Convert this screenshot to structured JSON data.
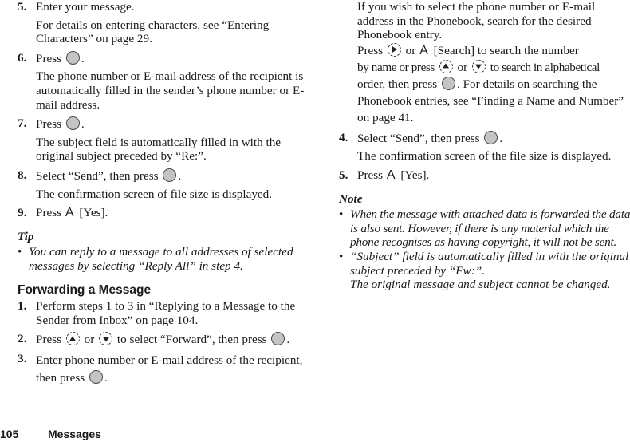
{
  "left_column": {
    "steps_top": [
      {
        "num": "5.",
        "text": "Enter your message.",
        "detail": "For details on entering characters, see “Entering Characters” on page 29."
      },
      {
        "num": "6.",
        "press_label": "Press",
        "press_suffix": ".",
        "detail": "The phone number or E-mail address of the recipient is automatically filled in the sender’s phone number or E-mail address."
      },
      {
        "num": "7.",
        "press_label": "Press",
        "press_suffix": ".",
        "detail": "The subject field is automatically filled in with the original subject preceded by “Re:”."
      },
      {
        "num": "8.",
        "text_before": "Select “Send”, then press",
        "text_after": ".",
        "detail": "The confirmation screen of file size is displayed."
      },
      {
        "num": "9.",
        "press_label": "Press",
        "softkey": "A",
        "action": "[Yes]."
      }
    ],
    "tip": {
      "label": "Tip",
      "bullets": [
        "You can reply to a message to all addresses of selected messages by selecting “Reply All” in step 4."
      ]
    },
    "section_heading": "Forwarding a Message",
    "steps_forward": [
      {
        "num": "1.",
        "text": "Perform steps 1 to 3 in “Replying to a Message to the Sender from Inbox” on page 104."
      },
      {
        "num": "2.",
        "press_label": "Press",
        "or_label": "or",
        "text_middle": "to select “Forward”, then press",
        "text_after": "."
      },
      {
        "num": "3.",
        "text_before": "Enter phone number or E-mail address of the recipient, then press",
        "text_after": "."
      }
    ]
  },
  "right_column": {
    "continuation": {
      "intro": "If you wish to select the phone number or E-mail address in the Phonebook, search for the desired Phonebook entry.",
      "press_label": "Press",
      "or_label": "or",
      "softkey": "A",
      "search_text": "[Search] to search the number",
      "by_name_text": "by name or press",
      "or_label_2": "or",
      "alpha_text": "to search in alphabetical",
      "order_text": "order, then press",
      "details_text": ". For details on searching the Phonebook entries, see “Finding a Name and Number” on page 41."
    },
    "steps": [
      {
        "num": "4.",
        "text_before": "Select “Send”, then press",
        "text_after": ".",
        "detail": "The confirmation screen of the file size is displayed."
      },
      {
        "num": "5.",
        "press_label": "Press",
        "softkey": "A",
        "action": "[Yes]."
      }
    ],
    "note": {
      "label": "Note",
      "bullets": [
        "When the message with attached data is forwarded the data is also sent. However, if there is any material which the phone recognises as having copyright, it will not be sent.",
        "“Subject” field is automatically filled in with the original subject preceded by “Fw:”.",
        "The original message and subject cannot be changed."
      ]
    }
  },
  "footer": {
    "page_number": "105",
    "section_name": "Messages"
  },
  "icons": {
    "center_key": "center-select-key",
    "nav_up": "navigation-up-key",
    "nav_down": "navigation-down-key",
    "nav_right": "navigation-right-key",
    "bullet": "•"
  }
}
